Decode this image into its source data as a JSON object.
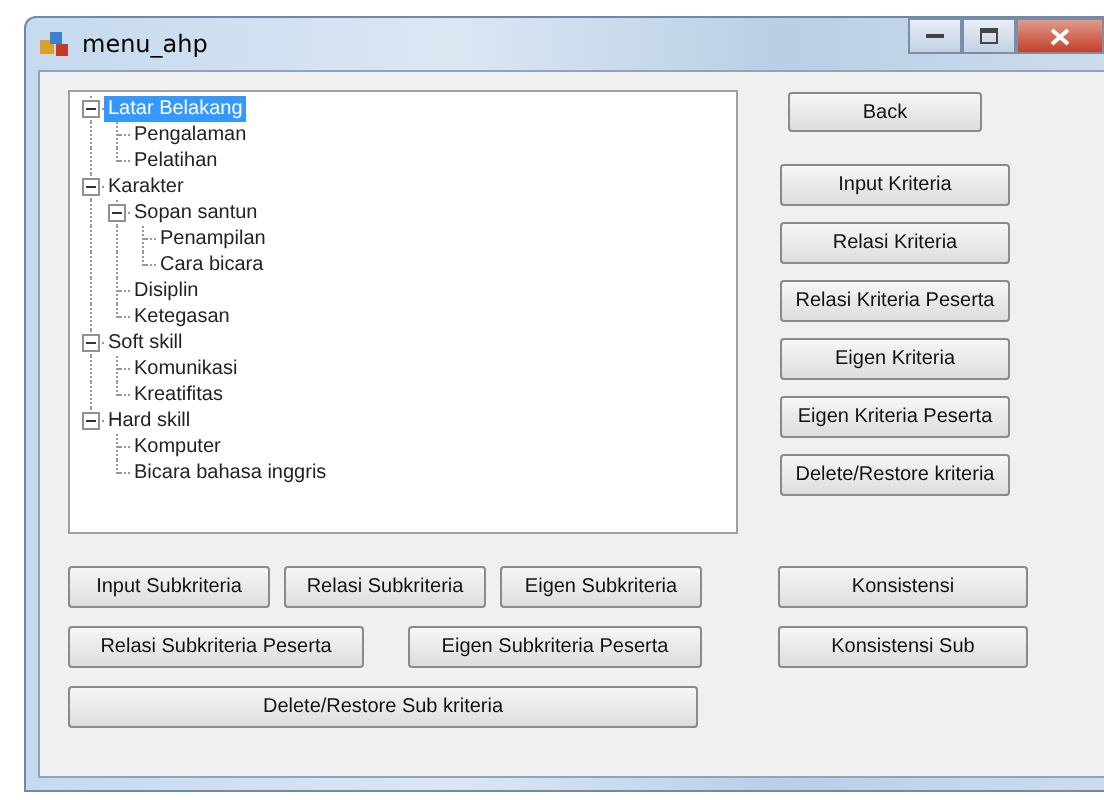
{
  "window": {
    "title": "menu_ahp"
  },
  "tree": [
    {
      "label": "Latar Belakang",
      "selected": true,
      "expanded": true,
      "children": [
        {
          "label": "Pengalaman",
          "selected": false
        },
        {
          "label": "Pelatihan",
          "selected": false
        }
      ]
    },
    {
      "label": "Karakter",
      "selected": false,
      "expanded": true,
      "children": [
        {
          "label": "Sopan santun",
          "selected": false,
          "expanded": true,
          "children": [
            {
              "label": "Penampilan",
              "selected": false
            },
            {
              "label": "Cara bicara",
              "selected": false
            }
          ]
        },
        {
          "label": "Disiplin",
          "selected": false
        },
        {
          "label": "Ketegasan",
          "selected": false
        }
      ]
    },
    {
      "label": "Soft skill",
      "selected": false,
      "expanded": true,
      "children": [
        {
          "label": "Komunikasi",
          "selected": false
        },
        {
          "label": "Kreatifitas",
          "selected": false
        }
      ]
    },
    {
      "label": "Hard skill",
      "selected": false,
      "expanded": true,
      "children": [
        {
          "label": "Komputer",
          "selected": false
        },
        {
          "label": "Bicara bahasa inggris",
          "selected": false
        }
      ]
    }
  ],
  "back_button": "Back",
  "kriteria_buttons": [
    "Input Kriteria",
    "Relasi Kriteria",
    "Relasi Kriteria Peserta",
    "Eigen Kriteria",
    "Eigen Kriteria Peserta",
    "Delete/Restore kriteria"
  ],
  "subkriteria_buttons": [
    "Input Subkriteria",
    "Relasi Subkriteria",
    "Eigen Subkriteria",
    "Relasi Subkriteria Peserta",
    "Eigen Subkriteria Peserta",
    "Delete/Restore Sub kriteria"
  ],
  "konsistensi_buttons": [
    "Konsistensi",
    "Konsistensi Sub"
  ]
}
